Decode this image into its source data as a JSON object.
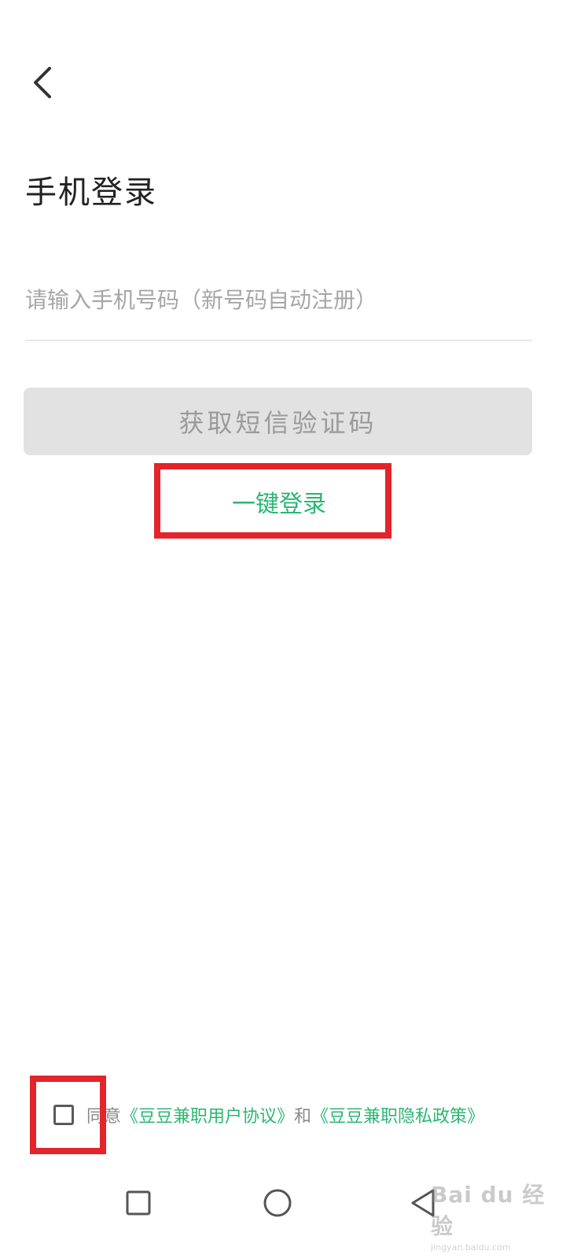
{
  "header": {
    "back_icon": "chevron-left-icon",
    "title": "手机登录"
  },
  "form": {
    "phone_placeholder": "请输入手机号码（新号码自动注册）",
    "phone_value": "",
    "sms_button_label": "获取短信验证码",
    "one_click_login_label": "一键登录"
  },
  "agreement": {
    "checked": false,
    "prefix": "同意",
    "user_agreement_link": "《豆豆兼职用户协议》",
    "conjunction": "和",
    "privacy_policy_link": "《豆豆兼职隐私政策》"
  },
  "annotations": {
    "highlight_color": "#e3242b"
  },
  "theme": {
    "accent": "#2bb673",
    "disabled_button_bg": "#e2e2e2",
    "disabled_button_text": "#9a9a9a"
  },
  "navbar": {
    "recents_icon": "square-icon",
    "home_icon": "circle-icon",
    "back_icon": "triangle-back-icon"
  },
  "watermark": {
    "main": "Bai du 经验",
    "sub": "jingyan.baidu.com"
  }
}
